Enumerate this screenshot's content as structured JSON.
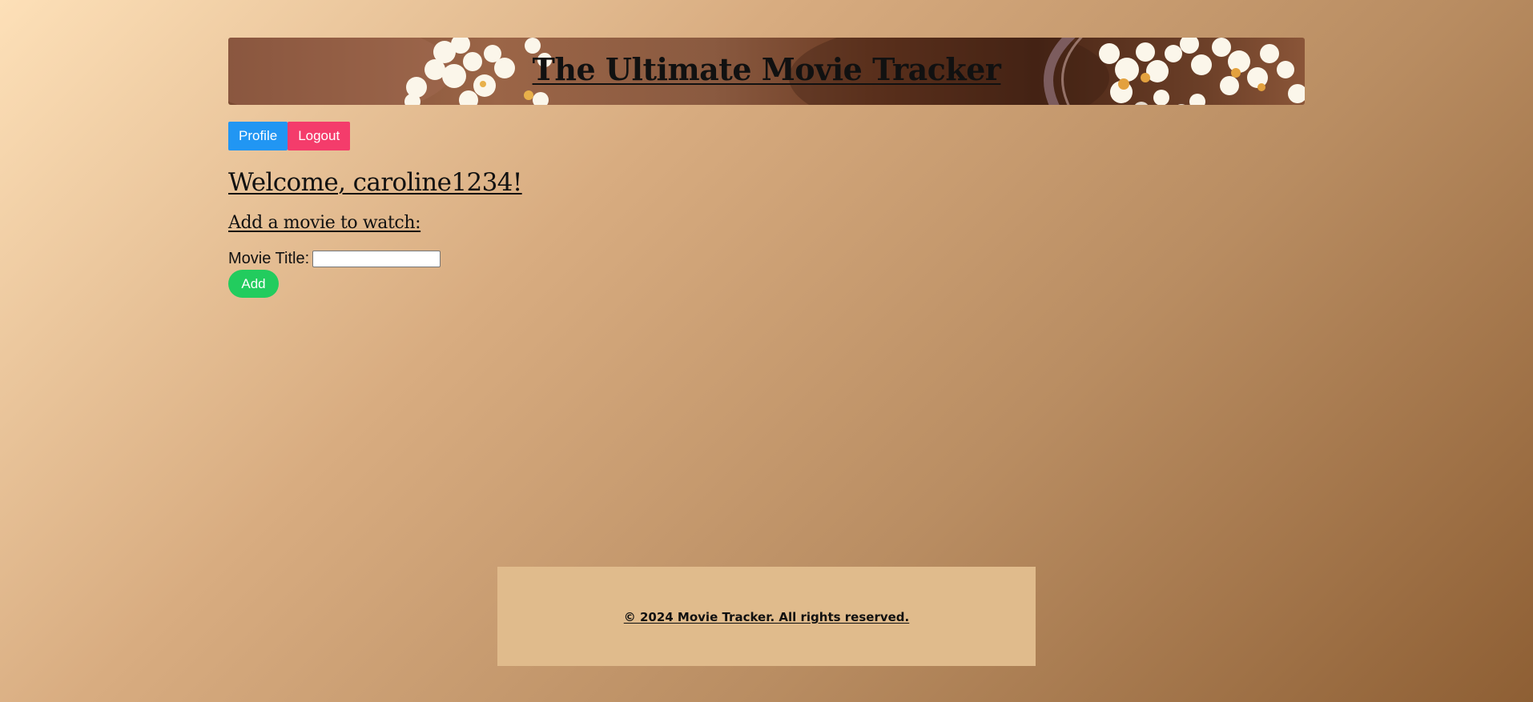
{
  "header": {
    "title": "The Ultimate Movie Tracker",
    "banner_image": "popcorn-banner"
  },
  "nav": {
    "profile_label": "Profile",
    "logout_label": "Logout"
  },
  "main": {
    "welcome": "Welcome, caroline1234!",
    "add_heading": "Add a movie to watch:",
    "movie_title_label": "Movie Title:",
    "movie_title_value": "",
    "add_label": "Add"
  },
  "footer": {
    "text": "© 2024 Movie Tracker. All rights reserved."
  },
  "colors": {
    "profile_button": "#2196f3",
    "logout_button": "#f43c6b",
    "add_button": "#22cc5e",
    "footer_background": "#e0bb8c",
    "page_gradient_start": "#fde0b8",
    "page_gradient_end": "#8e5f34"
  }
}
